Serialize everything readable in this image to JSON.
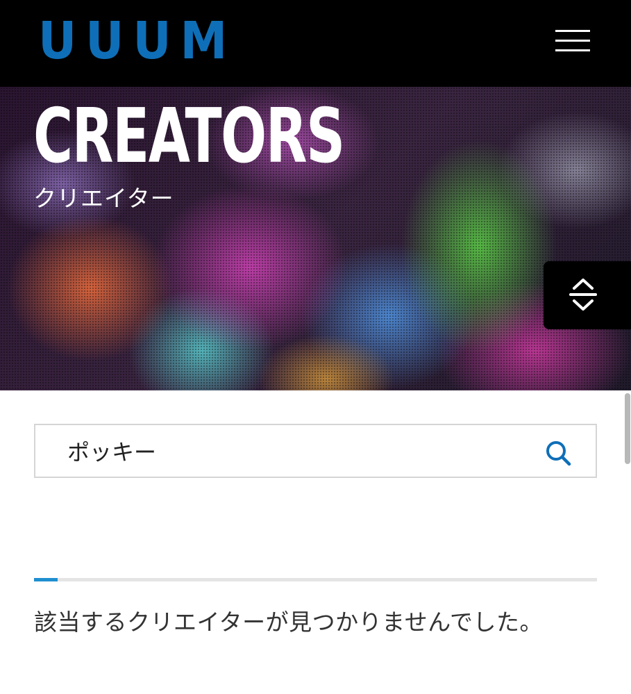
{
  "header": {
    "logo_text": "UUUM",
    "logo_color": "#0e6fb8",
    "menu_icon": "hamburger-menu-icon"
  },
  "hero": {
    "title": "CREATORS",
    "subtitle": "クリエイター"
  },
  "floating_button": {
    "icon": "expand-collapse-icon"
  },
  "search": {
    "value": "ポッキー",
    "icon": "search-icon",
    "accent_color": "#0e6fb8"
  },
  "results": {
    "tab_accent_color": "#1f8fcf",
    "empty_message": "該当するクリエイターが見つかりませんでした。"
  }
}
